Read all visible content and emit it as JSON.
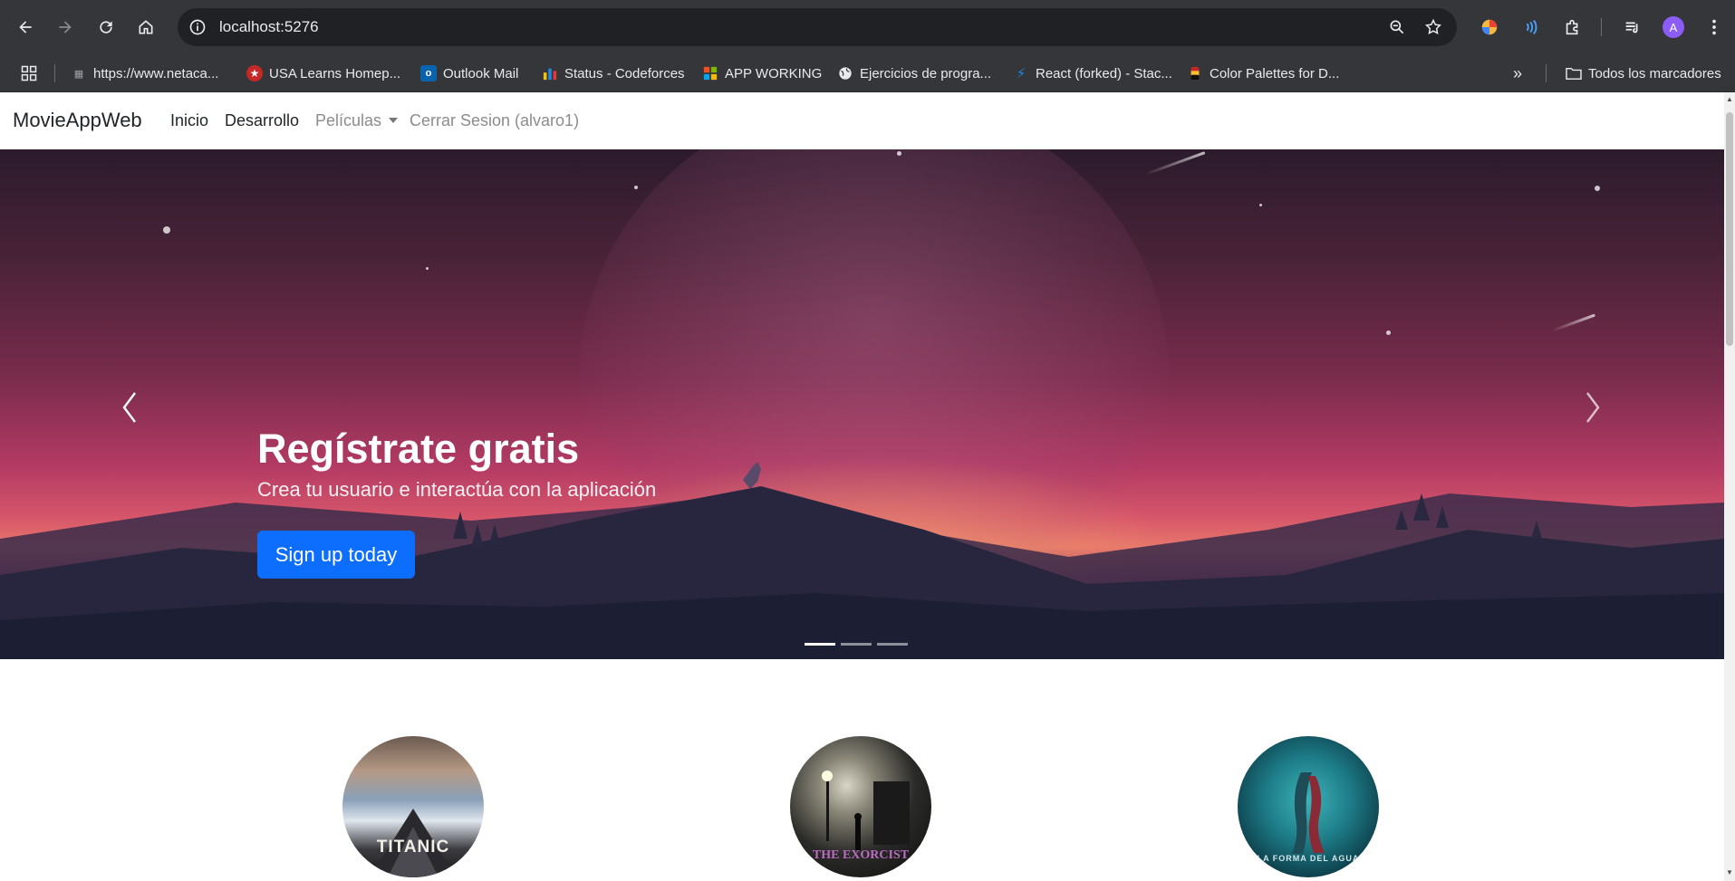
{
  "browser": {
    "url": "localhost:5276",
    "avatar_letter": "A",
    "bookmarks": [
      {
        "label": "https://www.netaca...",
        "icon": "netacad-icon"
      },
      {
        "label": "USA Learns Homep...",
        "icon": "star-badge-icon"
      },
      {
        "label": "Outlook Mail",
        "icon": "outlook-icon"
      },
      {
        "label": "Status - Codeforces",
        "icon": "codeforces-icon"
      },
      {
        "label": "APP WORKING",
        "icon": "microsoft-icon"
      },
      {
        "label": "Ejercicios de progra...",
        "icon": "globe-icon"
      },
      {
        "label": "React (forked) - Stac...",
        "icon": "stackblitz-icon"
      },
      {
        "label": "Color Palettes for D...",
        "icon": "palette-icon"
      }
    ],
    "all_bookmarks_label": "Todos los marcadores"
  },
  "site": {
    "brand": "MovieAppWeb",
    "nav": {
      "home": "Inicio",
      "dev": "Desarrollo",
      "movies": "Películas",
      "logout": "Cerrar Sesion (alvaro1)"
    }
  },
  "carousel": {
    "heading": "Regístrate gratis",
    "subtitle": "Crea tu usuario e interactúa con la aplicación",
    "cta": "Sign up today",
    "slide_count": 3,
    "active_slide": 1
  },
  "featured": {
    "posters": [
      "TITANIC",
      "THE EXORCIST",
      "LA FORMA DEL AGUA"
    ]
  },
  "colors": {
    "primary": "#0d6efd",
    "chrome_bg": "#35363a",
    "omnibox_bg": "#202124"
  }
}
